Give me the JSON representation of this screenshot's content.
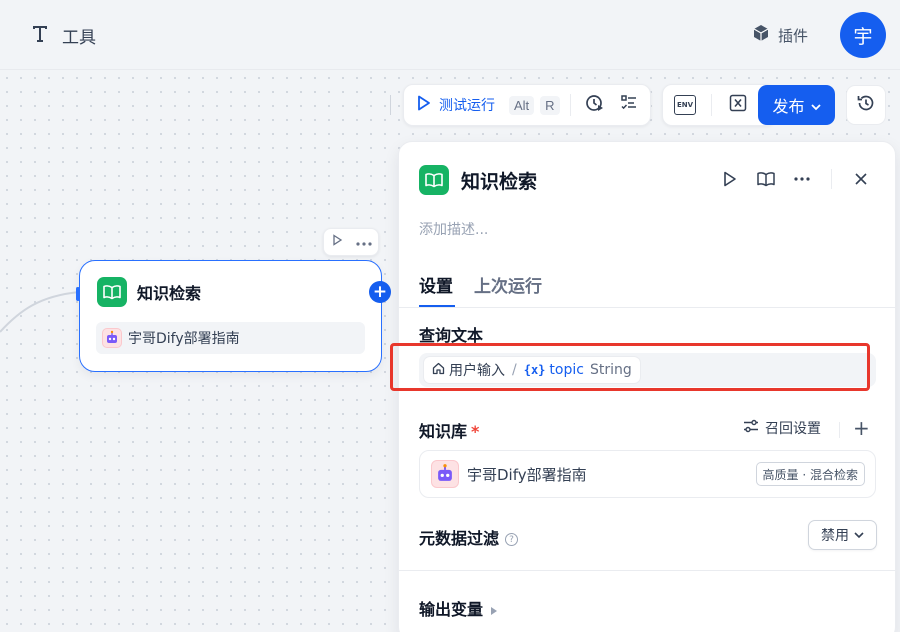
{
  "topbar": {
    "tools_label": "工具",
    "plugins_label": "插件",
    "avatar_initial": "宇"
  },
  "toolbar": {
    "test_run_label": "测试运行",
    "shortcut_keys": [
      "Alt",
      "R"
    ],
    "env_label": "ENV",
    "publish_label": "发布"
  },
  "node": {
    "title": "知识检索",
    "knowledge_base": "宇哥Dify部署指南"
  },
  "panel": {
    "title": "知识检索",
    "description_placeholder": "添加描述...",
    "tabs": [
      {
        "label": "设置",
        "active": true
      },
      {
        "label": "上次运行",
        "active": false
      }
    ],
    "query": {
      "label": "查询文本",
      "source_node": "用户输入",
      "separator": "/",
      "var_symbol": "{x}",
      "var_name": "topic",
      "var_type": "String"
    },
    "knowledge": {
      "label": "知识库",
      "required_mark": "*",
      "recall_settings_label": "召回设置",
      "add_label": "+",
      "item_name": "宇哥Dify部署指南",
      "item_badge": "高质量 · 混合检索"
    },
    "metadata_filter": {
      "label": "元数据过滤",
      "help": "?",
      "value": "禁用"
    },
    "output_vars": {
      "label": "输出变量"
    }
  },
  "colors": {
    "primary": "#155eef",
    "kb_green": "#16b364",
    "highlight_red": "#e8372c"
  }
}
